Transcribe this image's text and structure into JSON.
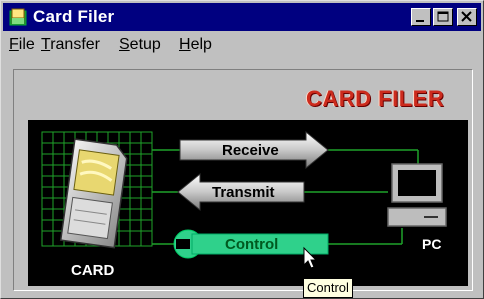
{
  "window": {
    "title": "Card Filer"
  },
  "menu": [
    {
      "label": "File",
      "u": "F",
      "rest": "ile"
    },
    {
      "label": "Transfer",
      "u": "T",
      "rest": "ransfer"
    },
    {
      "label": "Setup",
      "u": "S",
      "rest": "etup"
    },
    {
      "label": "Help",
      "u": "H",
      "rest": "elp"
    }
  ],
  "logo": "CARD FILER",
  "panel": {
    "receive_label": "Receive",
    "transmit_label": "Transmit",
    "control_label": "Control",
    "card_label": "CARD",
    "pc_label": "PC"
  },
  "tooltip": "Control",
  "colors": {
    "titlebar": "#000080",
    "grid": "#1fa32a",
    "control_green": "#2fd18b",
    "logo_red": "#cc2b1d"
  },
  "icons": [
    "app-card-icon",
    "sd-card-icon",
    "computer-icon",
    "wrench-icon",
    "cursor-icon"
  ]
}
